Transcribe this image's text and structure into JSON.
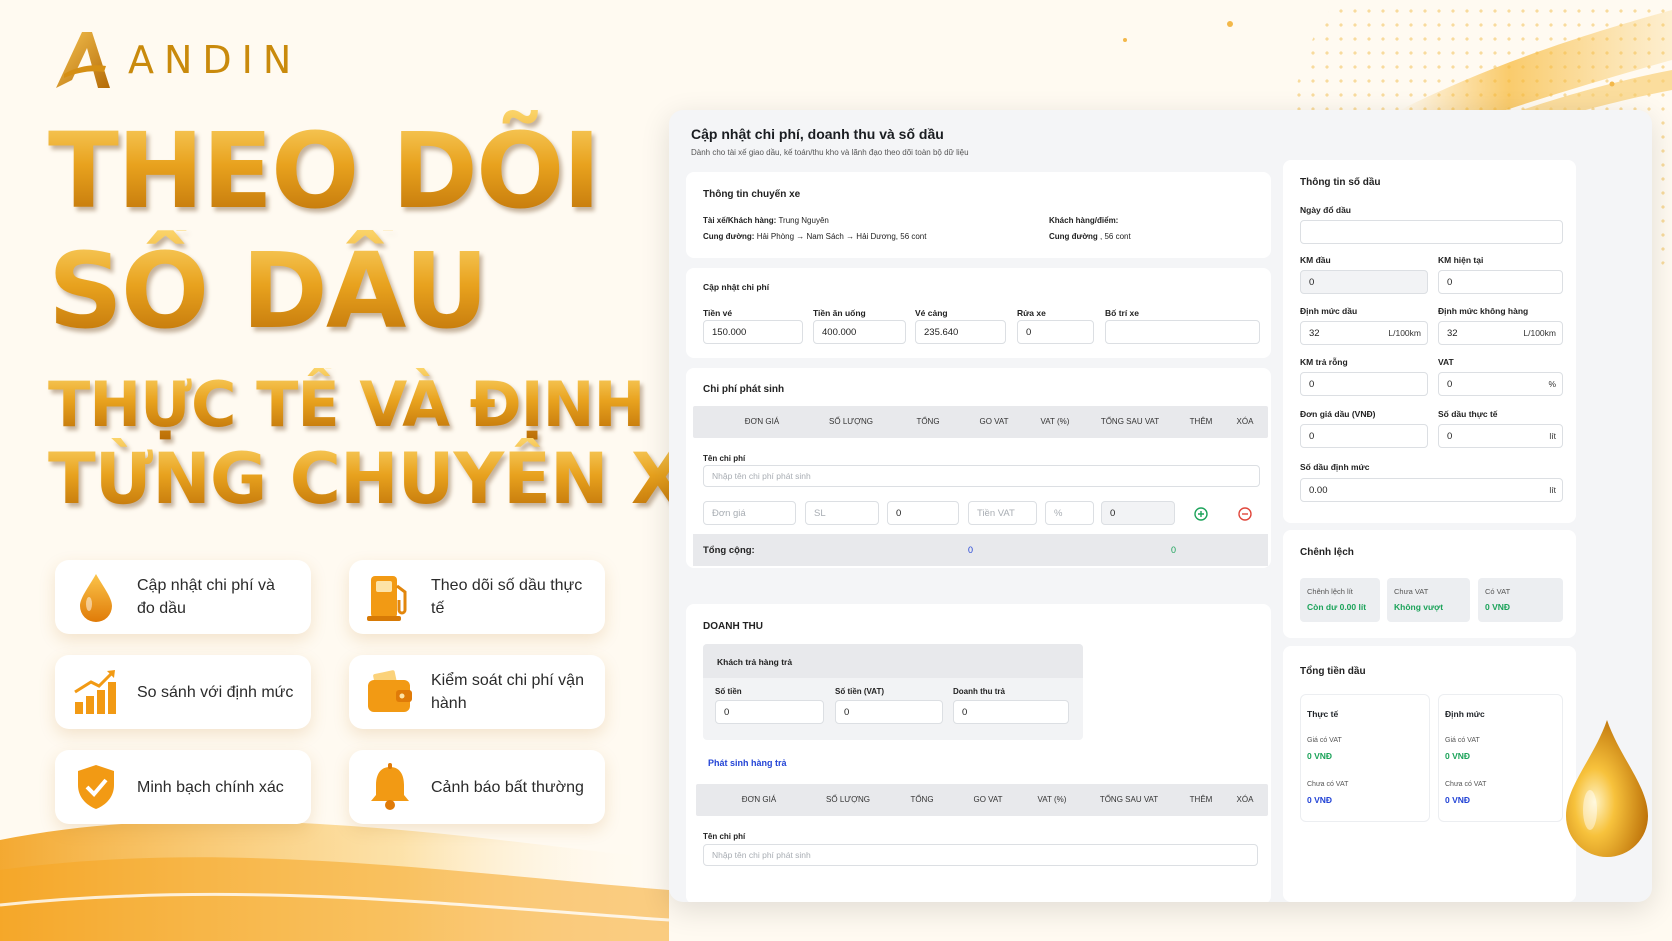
{
  "brand": {
    "name": "ANDIN"
  },
  "headline": {
    "line1": "THEO DÕI",
    "line2": "SỐ DẦU",
    "line3": "THỰC TẾ VÀ ĐỊNH MỨC",
    "line4": "TỪNG CHUYẾN XE"
  },
  "features": [
    {
      "label": "Cập nhật chi phí và đo dầu",
      "icon": "oil-drop-icon"
    },
    {
      "label": "Theo dõi số dầu thực tế",
      "icon": "fuel-pump-icon"
    },
    {
      "label": "So sánh với định mức",
      "icon": "bar-chart-up-icon"
    },
    {
      "label": "Kiểm soát chi phí vận hành",
      "icon": "wallet-icon"
    },
    {
      "label": "Minh bạch chính xác",
      "icon": "shield-check-icon"
    },
    {
      "label": "Cảnh báo bất thường",
      "icon": "bell-icon"
    }
  ],
  "panel": {
    "title": "Cập nhật  chi phí, doanh thu và số dầu",
    "subtitle": "Dành cho tài xế giao dầu, kế toán/thu kho và lãnh đạo theo dõi toàn bộ dữ liệu",
    "trip": {
      "title": "Thông tin chuyến xe",
      "driver_label": "Tài xế/Khách hàng:",
      "driver_value": " Trung Nguyên",
      "route_label": "Cung đường:",
      "route_value": " Hải Phòng → Nam Sách → Hải Dương, 56 cont",
      "customer_label": "Khách hàng/điểm:",
      "customer_value": "",
      "route2_label": "Cung đường",
      "route2_value": " , 56 cont"
    },
    "costs": {
      "title": "Cập nhật chi phí",
      "fields": [
        {
          "label": "Tiền vé",
          "value": "150.000"
        },
        {
          "label": "Tiền ăn uống",
          "value": "400.000"
        },
        {
          "label": "Vé cảng",
          "value": "235.640"
        },
        {
          "label": "Rửa xe",
          "value": "0"
        },
        {
          "label": "Bố trí xe",
          "value": ""
        }
      ]
    },
    "extra": {
      "title": "Chi phí phát sinh",
      "columns": [
        "ĐƠN GIÁ",
        "SỐ LƯỢNG",
        "TỔNG",
        "GO  VAT",
        "VAT (%)",
        "TỔNG SAU VAT",
        "THÊM",
        "XÓA"
      ],
      "name_label": "Tên chi phí",
      "name_placeholder": "Nhập tên chi phí phát sinh",
      "price_placeholder": "Đơn giá",
      "qty_placeholder": "SL",
      "total_value": "0",
      "vat_placeholder": "Tiền VAT",
      "pct_placeholder": "%",
      "after_vat_value": "0",
      "sum_label": "Tổng cộng:",
      "sum_total": "0",
      "sum_after_vat": "0"
    },
    "revenue": {
      "title": "DOANH THU",
      "box_title": "Khách trả hàng trả",
      "fields": [
        {
          "label": "Số tiền",
          "value": "0"
        },
        {
          "label": "Số tiền (VAT)",
          "value": "0"
        },
        {
          "label": "Doanh thu trả",
          "value": "0"
        }
      ],
      "link": "Phát sinh hàng trả",
      "columns": [
        "ĐƠN GIÁ",
        "SỐ LƯỢNG",
        "TỔNG",
        "GO  VAT",
        "VAT (%)",
        "TỔNG SAU VAT",
        "THÊM",
        "XÓA"
      ],
      "name_label": "Tên chi phí",
      "name_placeholder": "Nhập tên chi phí phát sinh"
    },
    "fuel": {
      "title": "Thông tin số dầu",
      "date_label": "Ngày đổ dầu",
      "date_value": "",
      "km_start_label": "KM đầu",
      "km_start": "0",
      "km_now_label": "KM hiện tại",
      "km_now": "0",
      "norm_label": "Định mức dầu",
      "norm": "32",
      "norm_unit": "L/100km",
      "norm_empty_label": "Định mức không hàng",
      "norm_empty": "32",
      "norm_empty_unit": "L/100km",
      "km_empty_label": "KM trả rỗng",
      "km_empty": "0",
      "vat_label": "VAT",
      "vat": "0",
      "vat_unit": "%",
      "price_label": "Đơn giá dầu (VNĐ)",
      "price": "0",
      "actual_label": "Số dầu thực tế",
      "actual": "0",
      "actual_unit": "lít",
      "norm_total_label": "Số dầu định mức",
      "norm_total": "0.00",
      "norm_total_unit": "lít"
    },
    "diff": {
      "title": "Chênh lệch",
      "chips": [
        {
          "label": "Chênh lệch lít",
          "value": "Còn dư 0.00 lít"
        },
        {
          "label": "Chưa VAT",
          "value": "Không vượt"
        },
        {
          "label": "Có VAT",
          "value": "0 VNĐ"
        }
      ]
    },
    "total": {
      "title": "Tổng tiền dầu",
      "actual": {
        "title": "Thực tế",
        "vat_label": "Giá có VAT",
        "vat_value": "0 VNĐ",
        "novat_label": "Chưa có VAT",
        "novat_value": "0 VNĐ"
      },
      "norm": {
        "title": "Định mức",
        "vat_label": "Giá có VAT",
        "vat_value": "0 VNĐ",
        "novat_label": "Chưa có VAT",
        "novat_value": "0 VNĐ"
      }
    }
  },
  "colors": {
    "gold": "#e8a21e",
    "green": "#1ca35a",
    "blue": "#2344d6",
    "red": "#e0463b"
  }
}
